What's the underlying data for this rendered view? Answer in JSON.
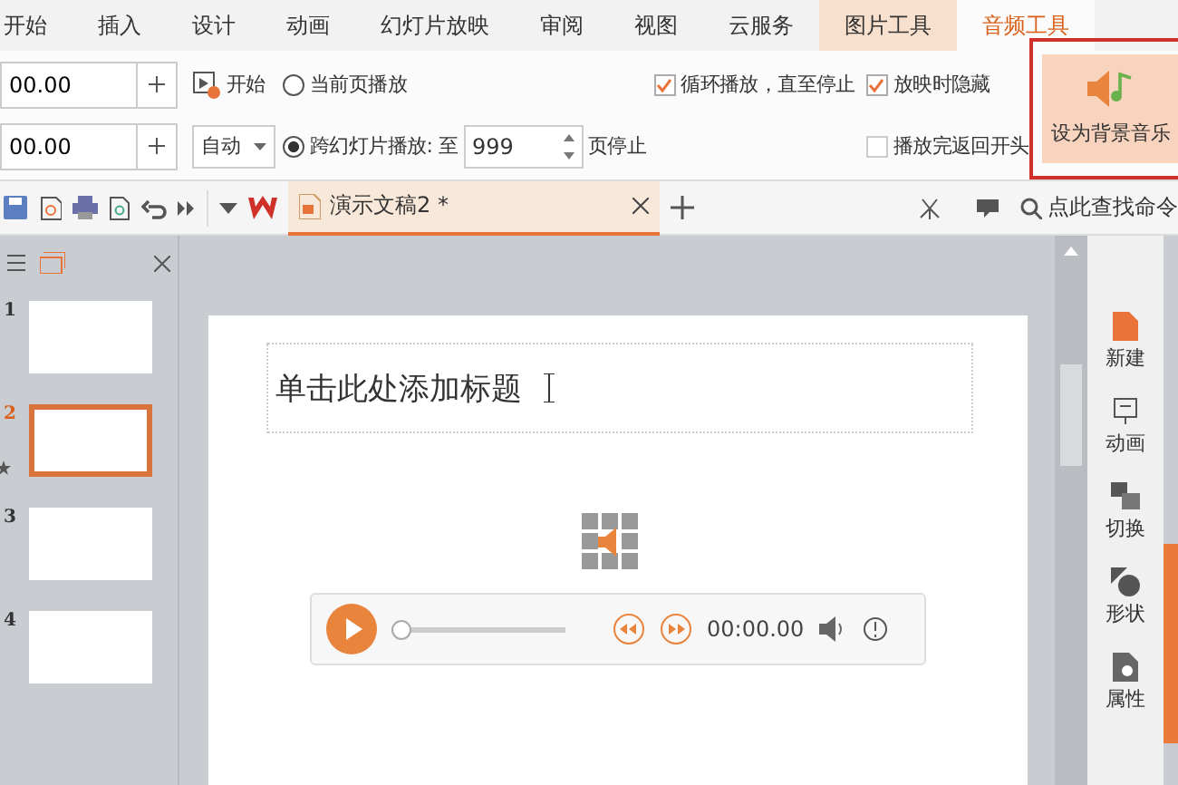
{
  "tabs": [
    {
      "label": "开始",
      "selected": false
    },
    {
      "label": "插入",
      "selected": false
    },
    {
      "label": "设计",
      "selected": false
    },
    {
      "label": "动画",
      "selected": false
    },
    {
      "label": "幻灯片放映",
      "selected": false
    },
    {
      "label": "审阅",
      "selected": false
    },
    {
      "label": "视图",
      "selected": false
    },
    {
      "label": "云服务",
      "selected": false
    },
    {
      "label": "图片工具",
      "selected": false
    },
    {
      "label": "音频工具",
      "selected": true
    }
  ],
  "ribbon": {
    "fade_in": "00.00",
    "fade_out": "00.00",
    "start_label": "开始",
    "start_mode": "自动",
    "play_options": [
      {
        "label": "当前页播放",
        "selected": false
      },
      {
        "label": "跨幻灯片播放: 至",
        "selected": true
      }
    ],
    "stop_page": "999",
    "stop_label": "页停止",
    "checks": [
      {
        "label": "循环播放，直至停止",
        "checked": true
      },
      {
        "label": "放映时隐藏",
        "checked": true
      },
      {
        "label": "播放完返回开头",
        "checked": false
      }
    ],
    "bg_music_button": "设为背景音乐"
  },
  "toolbar": {
    "doc_tab": "演示文稿2 *",
    "search": "点此查找命令"
  },
  "slides": [
    {
      "number": "1",
      "selected": false
    },
    {
      "number": "2",
      "selected": true
    },
    {
      "number": "3",
      "selected": false
    },
    {
      "number": "4",
      "selected": false
    }
  ],
  "slide": {
    "title_placeholder": "单击此处添加标题"
  },
  "player": {
    "time": "00:00.00",
    "level": 0
  },
  "sidebar": [
    {
      "label": "新建",
      "kind": "new"
    },
    {
      "label": "动画",
      "kind": "animation"
    },
    {
      "label": "切换",
      "kind": "transition"
    },
    {
      "label": "形状",
      "kind": "shape"
    },
    {
      "label": "属性",
      "kind": "property"
    }
  ]
}
